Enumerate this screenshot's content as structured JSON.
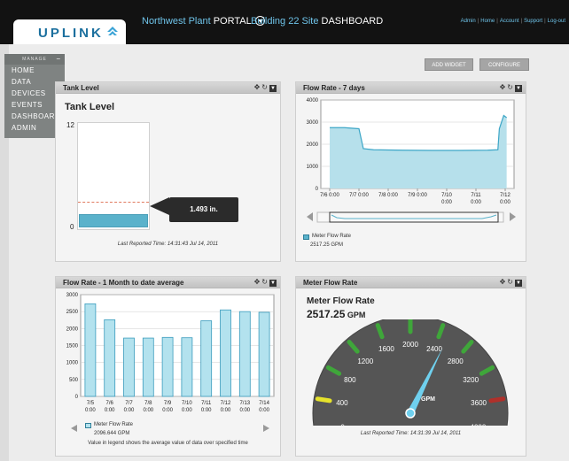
{
  "header": {
    "logo": "UPLINK",
    "portal_name": "Northwest Plant",
    "portal_label": "PORTAL",
    "site_name": "Building 22 Site",
    "site_label": "DASHBOARD",
    "links": [
      "Admin",
      "Home",
      "Account",
      "Support",
      "Log-out"
    ]
  },
  "menu": {
    "title": "MANAGE",
    "minimize": "−",
    "items": [
      "HOME",
      "DATA",
      "DEVICES",
      "EVENTS",
      "DASHBOARDS",
      "ADMIN"
    ]
  },
  "toolbar": {
    "add_widget": "ADD WIDGET",
    "configure": "CONFIGURE"
  },
  "tank": {
    "panel_title": "Tank Level",
    "heading": "Tank Level",
    "axis_top": "12",
    "axis_bottom": "0",
    "value_label": "1.493 in.",
    "level_value": 1.493,
    "axis_max": 12,
    "reported": "Last Reported Time: 14:31:43 Jul 14, 2011",
    "colors": {
      "fill": "#5ab2cb",
      "line": "#e07a5f"
    }
  },
  "flow7": {
    "panel_title": "Flow Rate - 7 days",
    "y_ticks": [
      "0",
      "1000",
      "2000",
      "3000",
      "4000"
    ],
    "x_ticks": [
      [
        "7/6 0:00"
      ],
      [
        "7/7 0:00"
      ],
      [
        "7/8 0:00"
      ],
      [
        "7/9 0:00"
      ],
      [
        "7/10",
        "0:00"
      ],
      [
        "7/11",
        "0:00"
      ],
      [
        "7/12",
        "0:00"
      ]
    ],
    "legend_name": "Meter Flow Rate",
    "legend_value": "2517.25 GPM"
  },
  "flowMonth": {
    "panel_title": "Flow Rate - 1 Month to date average",
    "legend_name": "Meter Flow Rate",
    "legend_value": "2096.644 GPM",
    "note": "Value in legend shows the average value of data over specified time"
  },
  "gauge": {
    "panel_title": "Meter Flow Rate",
    "heading": "Meter Flow Rate",
    "value": "2517.25",
    "unit": "GPM",
    "needle_unit": "GPM",
    "ticks": [
      "0",
      "400",
      "800",
      "1200",
      "1600",
      "2000",
      "2400",
      "2800",
      "3200",
      "3600",
      "4000"
    ],
    "min": 0,
    "max": 4000,
    "reading": 2517.25,
    "reported": "Last Reported Time: 14:31:39 Jul 14, 2011"
  },
  "chart_data": [
    {
      "type": "area",
      "title": "Flow Rate - 7 days",
      "x": [
        "7/6 0:00",
        "7/7 0:00",
        "7/8 0:00",
        "7/9 0:00",
        "7/10 0:00",
        "7/11 0:00",
        "7/12 0:00"
      ],
      "ylim": [
        0,
        4000
      ],
      "series": [
        {
          "name": "Meter Flow Rate",
          "points": [
            [
              0,
              2750
            ],
            [
              0.5,
              2750
            ],
            [
              1.0,
              2700
            ],
            [
              1.15,
              1800
            ],
            [
              1.5,
              1750
            ],
            [
              2.5,
              1730
            ],
            [
              3.5,
              1720
            ],
            [
              4.5,
              1720
            ],
            [
              5.4,
              1730
            ],
            [
              5.75,
              1750
            ],
            [
              5.8,
              2700
            ],
            [
              5.95,
              3300
            ],
            [
              6.05,
              3200
            ]
          ]
        }
      ],
      "grid": true
    },
    {
      "type": "bar",
      "title": "Flow Rate - 1 Month to date average",
      "categories": [
        "7/5 0:00",
        "7/6 0:00",
        "7/7 0:00",
        "7/8 0:00",
        "7/9 0:00",
        "7/10 0:00",
        "7/11 0:00",
        "7/12 0:00",
        "7/13 0:00",
        "7/14 0:00"
      ],
      "ylim": [
        0,
        3000
      ],
      "series": [
        {
          "name": "Meter Flow Rate",
          "values": [
            2730,
            2260,
            1720,
            1720,
            1740,
            1730,
            2230,
            2550,
            2500,
            2480
          ]
        }
      ],
      "grid": true
    }
  ]
}
